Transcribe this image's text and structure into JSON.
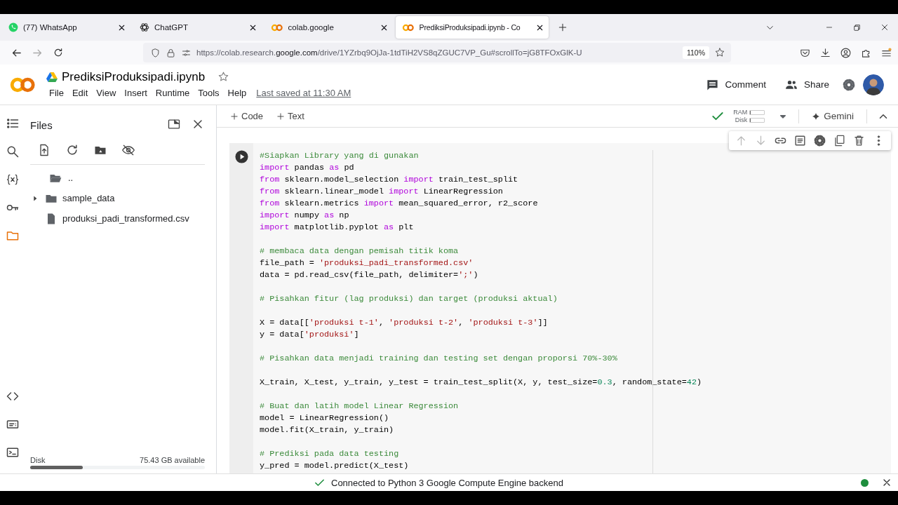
{
  "browser": {
    "tabs": [
      {
        "kind": "whatsapp",
        "title": "(77) WhatsApp",
        "selected": false
      },
      {
        "kind": "chatgpt",
        "title": "ChatGPT",
        "selected": false
      },
      {
        "kind": "colab",
        "title": "colab.google",
        "selected": false
      },
      {
        "kind": "colab",
        "title": "PrediksiProduksipadi.ipynb - Co",
        "selected": true
      }
    ],
    "address": {
      "start": "https://colab.research.",
      "domain": "google.com",
      "rest": "/drive/1YZrbq9OjJa-1tdTiH2VS8qZGUC7VP_Gu#scrollTo=jG8TFOxGlK-U",
      "zoom": "110%"
    }
  },
  "notebook": {
    "title": "PrediksiProduksipadi.ipynb",
    "menu": [
      "File",
      "Edit",
      "View",
      "Insert",
      "Runtime",
      "Tools",
      "Help"
    ],
    "last_saved": "Last saved at 11:30 AM",
    "comment": "Comment",
    "share": "Share"
  },
  "rail": [
    {
      "kind": "toc",
      "selected": false
    },
    {
      "kind": "search",
      "selected": false
    },
    {
      "kind": "variables",
      "selected": false
    },
    {
      "kind": "secrets",
      "selected": false
    },
    {
      "kind": "files",
      "selected": true
    }
  ],
  "rail_bottom": [
    {
      "kind": "code",
      "selected": false
    },
    {
      "kind": "palette",
      "selected": false
    },
    {
      "kind": "terminal",
      "selected": false
    }
  ],
  "files": {
    "title": "Files",
    "items": [
      {
        "kind": "parent",
        "name": ".."
      },
      {
        "kind": "folder",
        "name": "sample_data"
      },
      {
        "kind": "file",
        "name": "produksi_padi_transformed.csv"
      }
    ],
    "disk": {
      "label": "Disk",
      "available": "75.43 GB available",
      "level": 0.3
    }
  },
  "toolbar": {
    "add_code": "Code",
    "add_text": "Text",
    "resources": [
      {
        "label": "RAM",
        "level": 0.05
      },
      {
        "label": "Disk",
        "level": 0.05
      }
    ],
    "gemini": "Gemini"
  },
  "cell": {
    "lines": [
      {
        "kind": "code",
        "tokens": [
          {
            "kind": "comment",
            "text": "#Siapkan Library yang di gunakan"
          }
        ]
      },
      {
        "kind": "code",
        "tokens": [
          {
            "kind": "keyword",
            "text": "import"
          },
          {
            "kind": "plain",
            "text": " pandas "
          },
          {
            "kind": "keyword",
            "text": "as"
          },
          {
            "kind": "plain",
            "text": " pd"
          }
        ]
      },
      {
        "kind": "code",
        "tokens": [
          {
            "kind": "keyword",
            "text": "from"
          },
          {
            "kind": "plain",
            "text": " sklearn.model_selection "
          },
          {
            "kind": "keyword",
            "text": "import"
          },
          {
            "kind": "plain",
            "text": " train_test_split"
          }
        ]
      },
      {
        "kind": "code",
        "tokens": [
          {
            "kind": "keyword",
            "text": "from"
          },
          {
            "kind": "plain",
            "text": " sklearn.linear_model "
          },
          {
            "kind": "keyword",
            "text": "import"
          },
          {
            "kind": "plain",
            "text": " LinearRegression"
          }
        ]
      },
      {
        "kind": "code",
        "tokens": [
          {
            "kind": "keyword",
            "text": "from"
          },
          {
            "kind": "plain",
            "text": " sklearn.metrics "
          },
          {
            "kind": "keyword",
            "text": "import"
          },
          {
            "kind": "plain",
            "text": " mean_squared_error, r2_score"
          }
        ]
      },
      {
        "kind": "code",
        "tokens": [
          {
            "kind": "keyword",
            "text": "import"
          },
          {
            "kind": "plain",
            "text": " numpy "
          },
          {
            "kind": "keyword",
            "text": "as"
          },
          {
            "kind": "plain",
            "text": " np"
          }
        ]
      },
      {
        "kind": "code",
        "tokens": [
          {
            "kind": "keyword",
            "text": "import"
          },
          {
            "kind": "plain",
            "text": " matplotlib.pyplot "
          },
          {
            "kind": "keyword",
            "text": "as"
          },
          {
            "kind": "plain",
            "text": " plt"
          }
        ]
      },
      {
        "kind": "blank"
      },
      {
        "kind": "code",
        "tokens": [
          {
            "kind": "comment",
            "text": "# membaca data dengan pemisah titik koma"
          }
        ]
      },
      {
        "kind": "code",
        "tokens": [
          {
            "kind": "plain",
            "text": "file_path = "
          },
          {
            "kind": "string",
            "text": "'produksi_padi_transformed.csv'"
          }
        ]
      },
      {
        "kind": "code",
        "tokens": [
          {
            "kind": "plain",
            "text": "data = pd.read_csv(file_path, delimiter="
          },
          {
            "kind": "string",
            "text": "';'"
          },
          {
            "kind": "plain",
            "text": ")"
          }
        ]
      },
      {
        "kind": "blank"
      },
      {
        "kind": "code",
        "tokens": [
          {
            "kind": "comment",
            "text": "# Pisahkan fitur (lag produksi) dan target (produksi aktual)"
          }
        ]
      },
      {
        "kind": "blank"
      },
      {
        "kind": "code",
        "tokens": [
          {
            "kind": "plain",
            "text": "X = data[["
          },
          {
            "kind": "string",
            "text": "'produksi t-1'"
          },
          {
            "kind": "plain",
            "text": ", "
          },
          {
            "kind": "string",
            "text": "'produksi t-2'"
          },
          {
            "kind": "plain",
            "text": ", "
          },
          {
            "kind": "string",
            "text": "'produksi t-3'"
          },
          {
            "kind": "plain",
            "text": "]]"
          }
        ]
      },
      {
        "kind": "code",
        "tokens": [
          {
            "kind": "plain",
            "text": "y = data["
          },
          {
            "kind": "string",
            "text": "'produksi'"
          },
          {
            "kind": "plain",
            "text": "]"
          }
        ]
      },
      {
        "kind": "blank"
      },
      {
        "kind": "code",
        "tokens": [
          {
            "kind": "comment",
            "text": "# Pisahkan data menjadi training dan testing set dengan proporsi 70%-30%"
          }
        ]
      },
      {
        "kind": "blank"
      },
      {
        "kind": "code",
        "tokens": [
          {
            "kind": "plain",
            "text": "X_train, X_test, y_train, y_test = train_test_split(X, y, test_size="
          },
          {
            "kind": "number",
            "text": "0.3"
          },
          {
            "kind": "plain",
            "text": ", random_state="
          },
          {
            "kind": "number",
            "text": "42"
          },
          {
            "kind": "plain",
            "text": ")"
          }
        ]
      },
      {
        "kind": "blank"
      },
      {
        "kind": "code",
        "tokens": [
          {
            "kind": "comment",
            "text": "# Buat dan latih model Linear Regression"
          }
        ]
      },
      {
        "kind": "code",
        "tokens": [
          {
            "kind": "plain",
            "text": "model = LinearRegression()"
          }
        ]
      },
      {
        "kind": "code",
        "tokens": [
          {
            "kind": "plain",
            "text": "model.fit(X_train, y_train)"
          }
        ]
      },
      {
        "kind": "blank"
      },
      {
        "kind": "code",
        "tokens": [
          {
            "kind": "comment",
            "text": "# Prediksi pada data testing"
          }
        ]
      },
      {
        "kind": "code",
        "tokens": [
          {
            "kind": "plain",
            "text": "y_pred = model.predict(X_test)"
          }
        ]
      }
    ]
  },
  "status": {
    "message": "Connected to Python 3 Google Compute Engine backend"
  }
}
